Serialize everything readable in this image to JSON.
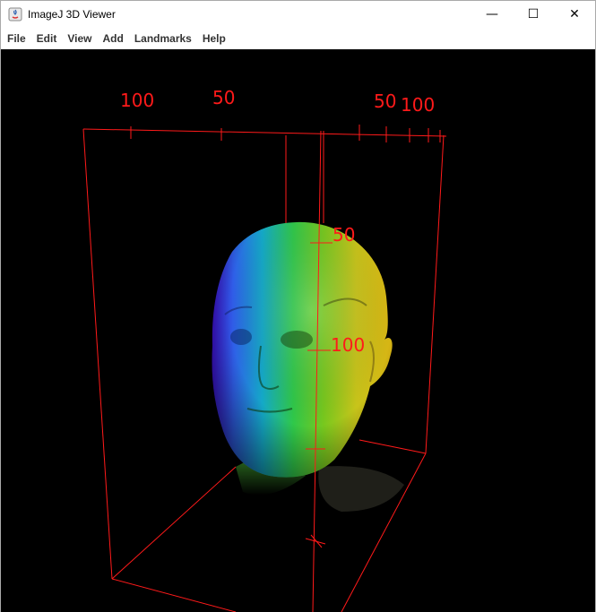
{
  "window": {
    "title": "ImageJ 3D Viewer",
    "controls": {
      "minimize": "—",
      "maximize": "☐",
      "close": "✕"
    }
  },
  "menu": {
    "items": [
      {
        "id": "file",
        "label": "File"
      },
      {
        "id": "edit",
        "label": "Edit"
      },
      {
        "id": "view",
        "label": "View"
      },
      {
        "id": "add",
        "label": "Add"
      },
      {
        "id": "landmarks",
        "label": "Landmarks"
      },
      {
        "id": "help",
        "label": "Help"
      }
    ]
  },
  "viewer": {
    "background": "#000000",
    "axis_color": "#ff1a1a",
    "axis_labels": {
      "top_left_100": "100",
      "top_left_50": "50",
      "top_right_50": "50",
      "top_right_100": "100",
      "vertical_50": "50",
      "vertical_100": "100"
    },
    "volume": "head-surface-rendering"
  }
}
